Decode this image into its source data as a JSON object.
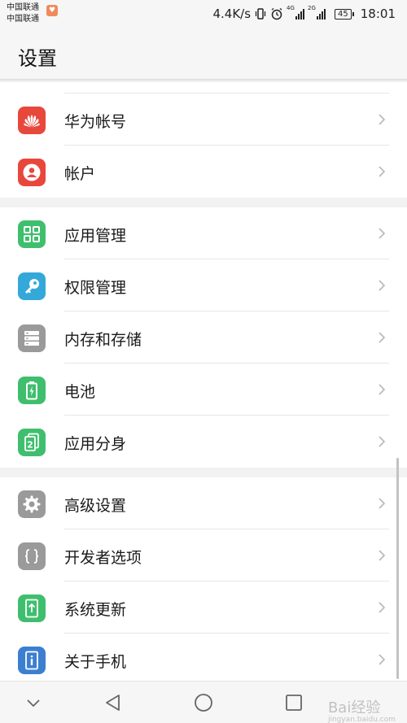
{
  "status_bar": {
    "carrier_1": "中国联通",
    "carrier_2": "中国联通",
    "speed": "4.4K/s",
    "net_1": "4G",
    "net_2": "2G",
    "battery": "45",
    "time": "18:01"
  },
  "header": {
    "title": "设置"
  },
  "groups": [
    {
      "items": [
        {
          "label": "华为帐号",
          "icon": "huawei-logo-icon",
          "color": "#e8473c"
        },
        {
          "label": "帐户",
          "icon": "account-person-icon",
          "color": "#e8473c"
        }
      ]
    },
    {
      "items": [
        {
          "label": "应用管理",
          "icon": "app-grid-icon",
          "color": "#3fbf6e"
        },
        {
          "label": "权限管理",
          "icon": "key-icon",
          "color": "#34a9d9"
        },
        {
          "label": "内存和存储",
          "icon": "storage-icon",
          "color": "#9a9a9a"
        },
        {
          "label": "电池",
          "icon": "battery-icon",
          "color": "#3fbf6e"
        },
        {
          "label": "应用分身",
          "icon": "app-twin-icon",
          "color": "#3fbf6e"
        }
      ]
    },
    {
      "items": [
        {
          "label": "高级设置",
          "icon": "gear-icon",
          "color": "#9a9a9a"
        },
        {
          "label": "开发者选项",
          "icon": "braces-icon",
          "color": "#9a9a9a"
        },
        {
          "label": "系统更新",
          "icon": "system-update-icon",
          "color": "#3fbf6e"
        },
        {
          "label": "关于手机",
          "icon": "phone-info-icon",
          "color": "#3c7fd0"
        }
      ]
    }
  ],
  "nav_bar": {
    "buttons": [
      "collapse-chevron-icon",
      "back-triangle-icon",
      "home-circle-icon",
      "recents-square-icon"
    ],
    "watermark": "Bai经验",
    "watermark_sub": "jingyan.baidu.com"
  }
}
